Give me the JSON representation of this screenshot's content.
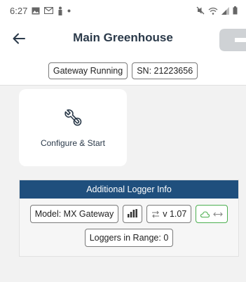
{
  "status_bar": {
    "time": "6:27",
    "left_icons": [
      "gallery-icon",
      "gmail-icon",
      "person-icon",
      "dot-icon"
    ],
    "right_icons": [
      "mute-icon",
      "wifi-icon",
      "signal-icon",
      "battery-icon"
    ]
  },
  "header": {
    "title": "Main Greenhouse",
    "back_icon": "back-arrow-icon",
    "logo_icon": "brand-logo"
  },
  "status_chips": {
    "gateway_status": "Gateway Running",
    "serial": "SN: 21223656"
  },
  "configure_card": {
    "icon": "wrench-icon",
    "label": "Configure & Start"
  },
  "logger_info": {
    "header": "Additional Logger Info",
    "model": "Model: MX Gateway",
    "signal_icon": "signal-strength-icon",
    "version": "v 1.07",
    "version_icon": "firmware-icon",
    "cloud_icon": "cloud-icon",
    "link_icon": "link-arrows-icon",
    "loggers_in_range": "Loggers in Range: 0"
  },
  "colors": {
    "accent_header": "#1f4f7d",
    "title_text": "#2b3a4a",
    "cloud_green": "#4caf50"
  }
}
